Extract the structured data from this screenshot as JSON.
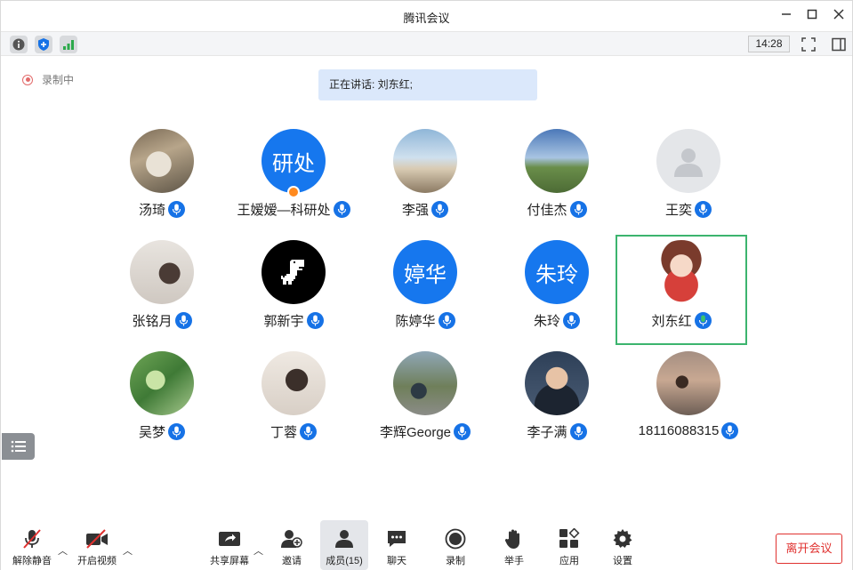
{
  "window": {
    "title": "腾讯会议"
  },
  "toolbar": {
    "time": "14:28"
  },
  "status": {
    "recording_label": "录制中",
    "speaking_label": "正在讲话: 刘东红;"
  },
  "participants": [
    {
      "name": "汤琦",
      "avatar": "photo",
      "avatar_desc": "woman-reading",
      "mic": "on"
    },
    {
      "name": "王嫒嫒—科研处",
      "avatar": "text",
      "avatar_text": "研处",
      "host": true,
      "mic": "on"
    },
    {
      "name": "李强",
      "avatar": "photo",
      "avatar_desc": "beach-seagulls",
      "mic": "on"
    },
    {
      "name": "付佳杰",
      "avatar": "photo",
      "avatar_desc": "man-on-grass",
      "mic": "on"
    },
    {
      "name": "王奕",
      "avatar": "placeholder",
      "mic": "on"
    },
    {
      "name": "张铭月",
      "avatar": "photo",
      "avatar_desc": "illustration-girl",
      "mic": "on"
    },
    {
      "name": "郭新宇",
      "avatar": "photo",
      "avatar_desc": "pixel-dinosaur",
      "mic": "on"
    },
    {
      "name": "陈婷华",
      "avatar": "text",
      "avatar_text": "婷华",
      "mic": "on"
    },
    {
      "name": "朱玲",
      "avatar": "text",
      "avatar_text": "朱玲",
      "mic": "on"
    },
    {
      "name": "刘东红",
      "avatar": "photo",
      "avatar_desc": "cartoon-girl",
      "mic": "speaking",
      "active": true
    },
    {
      "name": "吴梦",
      "avatar": "photo",
      "avatar_desc": "green-leaves",
      "mic": "on"
    },
    {
      "name": "丁蓉",
      "avatar": "photo",
      "avatar_desc": "selfie-woman",
      "mic": "on"
    },
    {
      "name": "李辉George",
      "avatar": "photo",
      "avatar_desc": "man-sitting-outdoor",
      "mic": "on"
    },
    {
      "name": "李子满",
      "avatar": "photo",
      "avatar_desc": "man-with-glasses",
      "mic": "on"
    },
    {
      "name": "18116088315",
      "avatar": "photo",
      "avatar_desc": "child-sunset",
      "mic": "on"
    }
  ],
  "bottombar": {
    "unmute": "解除静音",
    "start_video": "开启视频",
    "share_screen": "共享屏幕",
    "invite": "邀请",
    "members": "成员(15)",
    "chat": "聊天",
    "record": "录制",
    "raise_hand": "举手",
    "apps": "应用",
    "settings": "设置",
    "leave": "离开会议"
  },
  "colors": {
    "accent": "#1677ee",
    "speaking_border": "#3cb46e",
    "leave": "#e0312f"
  }
}
